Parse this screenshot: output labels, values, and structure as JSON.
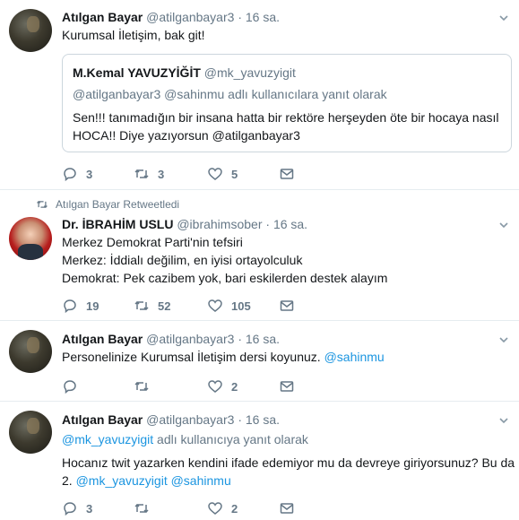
{
  "tweets": [
    {
      "name": "Atılgan Bayar",
      "handle": "@atilganbayar3",
      "dot": "·",
      "time": "16 sa.",
      "text": "Kurumsal İletişim, bak git!",
      "quote": {
        "name": "M.Kemal YAVUZYİĞİT",
        "handle": "@mk_yavuzyigit",
        "reply_to": "@atilganbayar3 @sahinmu adlı kullanıcılara yanıt olarak",
        "line1": "Sen!!! tanımadığın bir insana hatta bir rektöre herşeyden öte bir hocaya nasıl",
        "line2": "HOCA!! Diye yazıyorsun @atilganbayar3"
      },
      "replies": "3",
      "retweets": "3",
      "likes": "5"
    },
    {
      "retweeted_by": "Atılgan Bayar Retweetledi",
      "name": "Dr. İBRAHİM USLU",
      "handle": "@ibrahimsober",
      "dot": "·",
      "time": "16 sa.",
      "line1": "Merkez Demokrat Parti'nin tefsiri",
      "line2": "Merkez: İddialı değilim, en iyisi ortayolculuk",
      "line3": "Demokrat: Pek cazibem yok, bari eskilerden destek alayım",
      "replies": "19",
      "retweets": "52",
      "likes": "105"
    },
    {
      "name": "Atılgan Bayar",
      "handle": "@atilganbayar3",
      "dot": "·",
      "time": "16 sa.",
      "text": "Personelinize Kurumsal İletişim dersi koyunuz.",
      "mention": "@sahinmu",
      "replies": "",
      "retweets": "",
      "likes": "2"
    },
    {
      "name": "Atılgan Bayar",
      "handle": "@atilganbayar3",
      "dot": "·",
      "time": "16 sa.",
      "reply_mention": "@mk_yavuzyigit",
      "reply_suffix": "adlı kullanıcıya yanıt olarak",
      "line1": "Hocanız twit yazarken kendini ifade edemiyor mu da devreye giriyorsunuz? Bu da",
      "line2_prefix": "2.",
      "line2_mentions": "@mk_yavuzyigit @sahinmu",
      "replies": "3",
      "retweets": "",
      "likes": "2"
    }
  ],
  "icons": {
    "reply": "reply-icon",
    "retweet": "retweet-icon",
    "like": "heart-icon",
    "dm": "envelope-icon",
    "caret": "chevron-down-icon"
  },
  "colors": {
    "link": "#1b95e0",
    "secondary": "#657786",
    "border": "#e6ecf0"
  }
}
